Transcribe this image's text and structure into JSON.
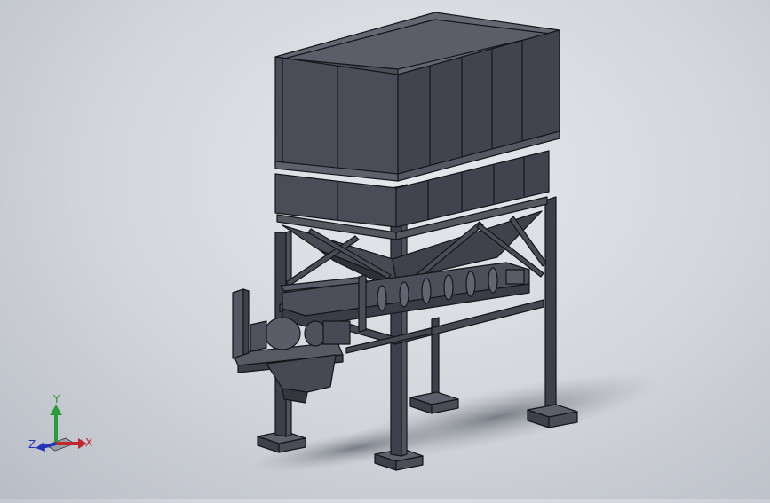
{
  "viewport": {
    "model": "hopper-screw-conveyor-assembly",
    "background_top": "#e6e8ec",
    "background_bottom": "#b9bdc5"
  },
  "triad": {
    "x_label": "X",
    "y_label": "Y",
    "z_label": "Z",
    "x_color": "#c0282d",
    "y_color": "#2a9a3a",
    "z_color": "#2434b8"
  },
  "model_colors": {
    "steel_dark": "#3d404a",
    "steel_mid": "#4f525c",
    "steel_light": "#5d606a",
    "edge": "#15161a"
  }
}
